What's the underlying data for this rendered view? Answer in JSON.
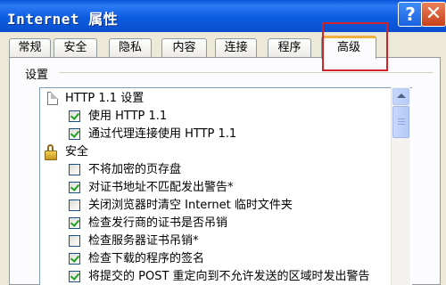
{
  "window": {
    "title": "Internet 属性",
    "help_glyph": "?",
    "close_glyph": "✕"
  },
  "tabs": [
    {
      "label": "常规"
    },
    {
      "label": "安全"
    },
    {
      "label": "隐私"
    },
    {
      "label": "内容"
    },
    {
      "label": "连接"
    },
    {
      "label": "程序"
    },
    {
      "label": "高级",
      "active": true
    }
  ],
  "settings": {
    "group_label": "设置",
    "items": [
      {
        "type": "category",
        "icon": "document-icon",
        "label": "HTTP 1.1 设置"
      },
      {
        "type": "checkbox",
        "checked": true,
        "label": "使用 HTTP 1.1"
      },
      {
        "type": "checkbox",
        "checked": true,
        "label": "通过代理连接使用 HTTP 1.1"
      },
      {
        "type": "category",
        "icon": "lock-icon",
        "label": "安全"
      },
      {
        "type": "checkbox",
        "checked": false,
        "label": "不将加密的页存盘"
      },
      {
        "type": "checkbox",
        "checked": true,
        "label": "对证书地址不匹配发出警告*"
      },
      {
        "type": "checkbox",
        "checked": false,
        "label": "关闭浏览器时清空 Internet 临时文件夹"
      },
      {
        "type": "checkbox",
        "checked": true,
        "label": "检查发行商的证书是否吊销"
      },
      {
        "type": "checkbox",
        "checked": false,
        "label": "检查服务器证书吊销*"
      },
      {
        "type": "checkbox",
        "checked": true,
        "label": "检查下载的程序的签名"
      },
      {
        "type": "checkbox",
        "checked": true,
        "label": "将提交的 POST 重定向到不允许发送的区域时发出警告"
      }
    ]
  },
  "colors": {
    "titlebar": "#0a55d8",
    "highlight_box": "#d0242a",
    "checkmark": "#21a121"
  }
}
